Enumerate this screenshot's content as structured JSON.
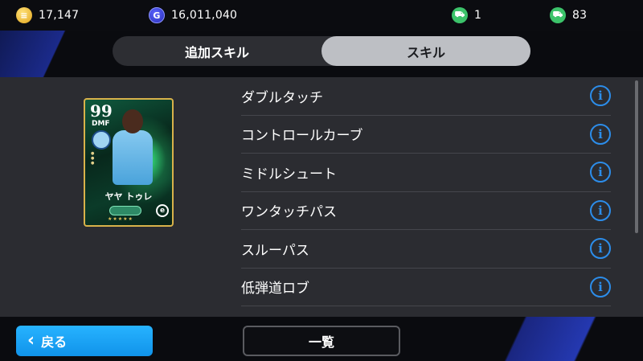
{
  "currency": {
    "coins": {
      "icon": "coin-icon",
      "value": "17,147"
    },
    "gp": {
      "icon": "gp-icon",
      "symbol": "G",
      "value": "16,011,040"
    },
    "ticket_a": {
      "icon": "ticket-icon",
      "value": "1"
    },
    "ticket_b": {
      "icon": "ticket-icon",
      "value": "83"
    }
  },
  "tabs": [
    {
      "label": "追加スキル",
      "active": false
    },
    {
      "label": "スキル",
      "active": true
    }
  ],
  "card": {
    "rating": "99",
    "position": "DMF",
    "name": "ヤヤ トゥレ",
    "logo": "e"
  },
  "skills": [
    {
      "label": "ダブルタッチ",
      "icon": "info-icon"
    },
    {
      "label": "コントロールカーブ",
      "icon": "info-icon"
    },
    {
      "label": "ミドルシュート",
      "icon": "info-icon"
    },
    {
      "label": "ワンタッチパス",
      "icon": "info-icon"
    },
    {
      "label": "スルーパス",
      "icon": "info-icon"
    },
    {
      "label": "低弾道ロブ",
      "icon": "info-icon"
    }
  ],
  "footer": {
    "back_label": "戻る",
    "list_label": "一覧"
  },
  "colors": {
    "accent_blue": "#1a9ef2",
    "info_blue": "#2c8dea",
    "panel": "#2b2c31",
    "tab_active": "#bdbfc4"
  }
}
